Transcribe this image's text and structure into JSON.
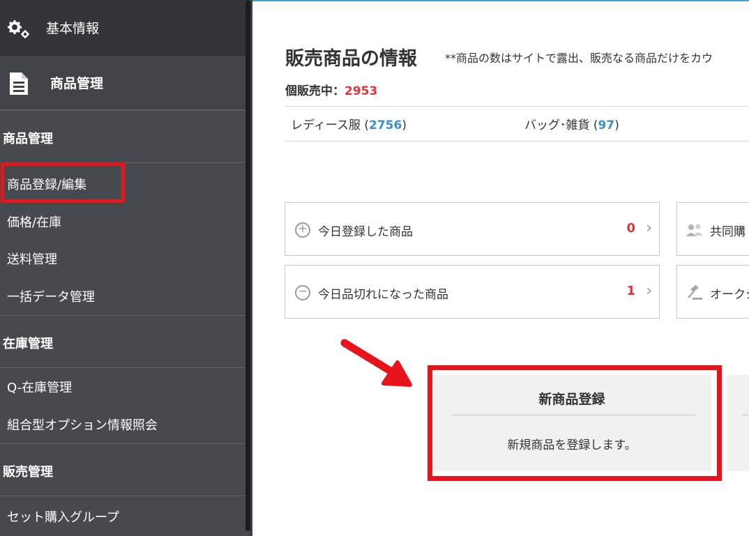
{
  "sidebar": {
    "top_item": {
      "label": "基本情報",
      "icon": "gears-icon"
    },
    "product_header": {
      "label": "商品管理",
      "icon": "document-icon"
    },
    "sections": [
      {
        "label": "商品管理",
        "items": [
          "商品登録/編集",
          "価格/在庫",
          "送料管理",
          "一括データ管理"
        ]
      },
      {
        "label": "在庫管理",
        "items": [
          "Q-在庫管理",
          "組合型オプション情報照会"
        ]
      },
      {
        "label": "販売管理",
        "items": [
          "セット購入グループ"
        ]
      }
    ],
    "highlighted_item": "商品登録/編集",
    "highlight_color": "#e8141b"
  },
  "main": {
    "title": "販売商品の情報",
    "note": "**商品の数はサイトで露出、販売なる商品だけをカウ",
    "selling_label": "個販売中：",
    "selling_count": "2953",
    "categories": [
      {
        "name": "レディース服",
        "open": "(",
        "count": "2756",
        "close": ")"
      },
      {
        "name": "バッグ･雑貨",
        "open": "(",
        "count": "97",
        "close": ")"
      }
    ],
    "stats": [
      {
        "label": "今日登録した商品",
        "value": "0",
        "icon": "plus-circle-icon",
        "chevron": "›"
      },
      {
        "label": "今日品切れになった商品",
        "value": "1",
        "icon": "minus-circle-icon",
        "chevron": "›"
      }
    ],
    "right_stats": [
      {
        "label": "共同購",
        "icon": "people-icon"
      },
      {
        "label": "オークシ",
        "icon": "gavel-icon"
      }
    ],
    "new_product_card": {
      "title": "新商品登録",
      "description": "新規商品を登録します。"
    },
    "accent_color": "#e53238",
    "link_color": "#3b8fcf"
  }
}
